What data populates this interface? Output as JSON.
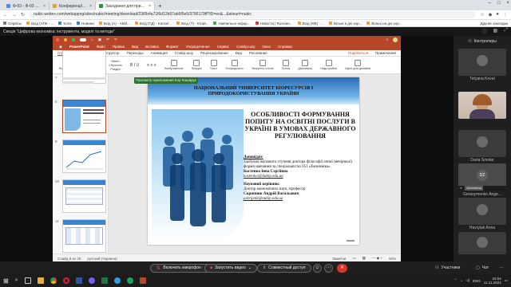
{
  "browser": {
    "tabs": [
      {
        "label": "Ф-03 - Ф-03 Програма Онлайн-...",
        "active": false
      },
      {
        "label": "Конференції для участі у ...",
        "active": false
      },
      {
        "label": "Заседания для пристойної...",
        "active": true
      }
    ],
    "url": "nubic.webex.com/webappng/sites/nubic/meeting/download/23f0b4a71f6d12b97ab5f5e5/3786179ff?ID=en&...&siteurl=nubic",
    "bookmarks": [
      "Сервісы",
      "Вхід (АПК - ...",
      "SoSc",
      "Новини",
      "Вхід (А) - АКМ...",
      "Вхід (ТД) - Kansel...",
      "Вхід (Т) - Кітай...",
      "Навчально-інфор...",
      "Новости | Russian...",
      "Вхід (ФВ) - ...",
      "Вільні в дні кор...",
      "Вільні на дні кор..."
    ],
    "bookmarks_right": "Другие закладки"
  },
  "webex": {
    "title": "Секція \"Цифрова економіка: інструменти, моделі та методи\"",
    "sharing_banner": "Просмотр приложения Ігор Кошарук",
    "participants_label": "Контролеры",
    "participants": [
      {
        "name": "Tetyana Koval",
        "kind": "avatar"
      },
      {
        "name": "",
        "kind": "video"
      },
      {
        "name": "Daria Smolar",
        "kind": "avatar"
      },
      {
        "name": "DZ",
        "kind": "self",
        "badge": "Організатор"
      },
      {
        "name": "Gerasymenko Ange...",
        "kind": "avatar"
      },
      {
        "name": "Havrylak Anna",
        "kind": "avatar"
      }
    ],
    "controls": {
      "mic": "Включить микрофон",
      "video": "Запустить видео",
      "share": "Совместный доступ",
      "participants": "Участники",
      "chat": "Чат"
    }
  },
  "ppt": {
    "app": "PowerPoint",
    "file_menu": [
      "Файл",
      "Правка",
      "Вид",
      "Вставка",
      "Формат",
      "Упорядочение",
      "Сервис",
      "Слайд-шоу",
      "Окно",
      "Справка"
    ],
    "ribbon_tabs": [
      "Главная",
      "Вставка",
      "Конструктор",
      "Переходы",
      "Анимация",
      "Слайд-шоу",
      "Рецензирование",
      "Вид",
      "Рисование"
    ],
    "ribbon_right": [
      "Поделиться",
      "Примечания"
    ],
    "ribbon_buttons": [
      "Вставить",
      "Создать слайд",
      "Макет",
      "Сбросить",
      "Раздел",
      "Изображение",
      "Фигуры",
      "Текст",
      "Упорядочить",
      "Экспресс-стили",
      "Поиск",
      "Диктовать",
      "Надстройки",
      "Идеи для дизайна"
    ],
    "status_left": "Слайд 8 из 28",
    "status_lang": "русский (Украина)",
    "status_right": "Заметки",
    "zoom": "90%",
    "thumbnail_numbers": [
      "7",
      "8",
      "9",
      "10",
      "11"
    ]
  },
  "slide": {
    "header": "НАЦІОНАЛЬНИЙ УНІВЕРСИТЕТ БІОРЕСУРСІВ І ПРИРОДОКОРИСТУВАННЯ УКРАЇНИ",
    "title": "ОСОБЛИВОСТІ ФОРМУВАННЯ ПОПИТУ НА ОСВІТНІ ПОСЛУГИ В УКРАЇНІ В УМОВАХ ДЕРЖАВНОГО РЕГУЛЮВАННЯ",
    "speaker_label": "Доповідач:",
    "speaker_desc": "Здобувач наукового ступеня доктора філософії очної (вечірньої) форми навчання за спеціальністю 051 «Економіка»",
    "speaker_name": "Костенко Інна Сергіївна",
    "speaker_email": "kostenkoi@nubip.edu.ua",
    "advisor_label": "Науковий керівник:",
    "advisor_desc": "Доктор економічних наук, професор",
    "advisor_name": "Скрипник Андрій Васильович",
    "advisor_email": "askripnik@nubip.edu.ua"
  },
  "taskbar": {
    "lang": "ENG",
    "time": "15:04",
    "date": "11.11.2021"
  }
}
